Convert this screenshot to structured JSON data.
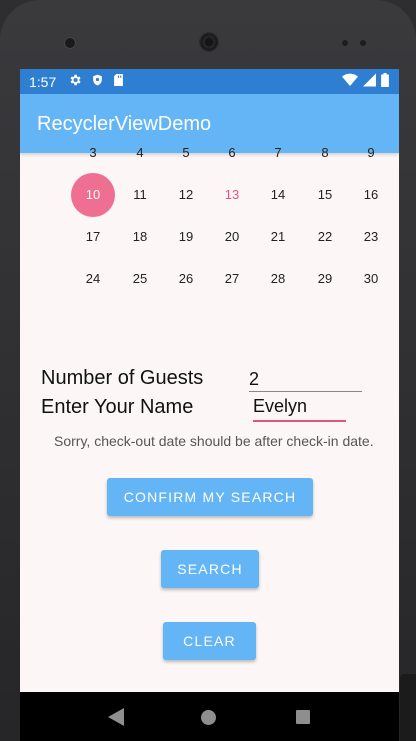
{
  "status_bar": {
    "time": "1:57"
  },
  "app_bar": {
    "title": "RecyclerViewDemo"
  },
  "calendar": {
    "partial_row": [
      "3",
      "4",
      "5",
      "6",
      "7",
      "8",
      "9"
    ],
    "rows": [
      [
        "",
        "10",
        "11",
        "12",
        "13",
        "14",
        "15",
        "16"
      ],
      [
        "",
        "17",
        "18",
        "19",
        "20",
        "21",
        "22",
        "23"
      ],
      [
        "",
        "24",
        "25",
        "26",
        "27",
        "28",
        "29",
        "30"
      ]
    ],
    "selected_day": "10",
    "highlight_day": "13"
  },
  "form": {
    "guests_label": "Number of Guests",
    "guests_value": "2",
    "name_label": "Enter Your Name",
    "name_value": "Evelyn",
    "error_message": "Sorry, check-out date should be after check-in date."
  },
  "buttons": {
    "confirm": "CONFIRM MY SEARCH",
    "search": "SEARCH",
    "clear": "CLEAR"
  },
  "colors": {
    "status": "#2e7fd2",
    "appbar": "#64b5f6",
    "accent": "#ef6f91"
  },
  "icons": [
    "settings-icon",
    "shield-icon",
    "sd-card-icon",
    "wifi-icon",
    "signal-icon",
    "battery-icon",
    "back-icon",
    "home-icon",
    "recents-icon"
  ]
}
